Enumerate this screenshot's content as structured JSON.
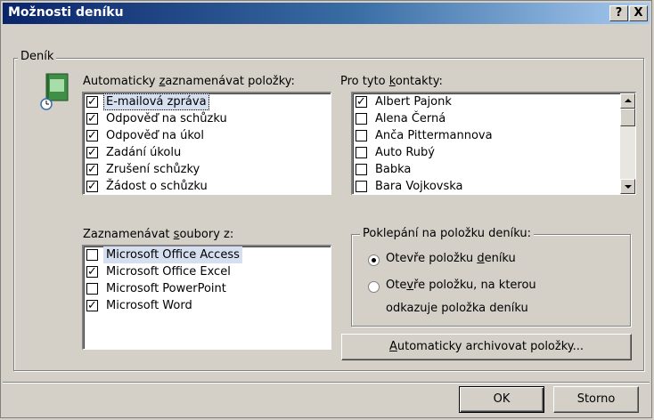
{
  "window": {
    "title": "Možnosti deníku",
    "help_button": "?",
    "close_button": "X"
  },
  "group": {
    "legend": "Deník"
  },
  "auto_record": {
    "label_pre": "Automaticky ",
    "label_u": "z",
    "label_post": "aznamenávat položky:",
    "items": [
      {
        "label": "E-mailová zpráva",
        "checked": true
      },
      {
        "label": "Odpověď na schůzku",
        "checked": true
      },
      {
        "label": "Odpověď na úkol",
        "checked": true
      },
      {
        "label": "Zadání úkolu",
        "checked": true
      },
      {
        "label": "Zrušení schůzky",
        "checked": true
      },
      {
        "label": "Žádost o schůzku",
        "checked": true
      }
    ]
  },
  "contacts": {
    "label_pre": "Pro tyto ",
    "label_u": "k",
    "label_post": "ontakty:",
    "items": [
      {
        "label": "Albert Pajonk",
        "checked": true
      },
      {
        "label": "Alena Černá",
        "checked": false
      },
      {
        "label": "Anča Pittermannova",
        "checked": false
      },
      {
        "label": "Auto Rubý",
        "checked": false
      },
      {
        "label": "Babka",
        "checked": false
      },
      {
        "label": "Bara Vojkovska",
        "checked": false
      }
    ]
  },
  "files": {
    "label_pre": "Zaznamenávat ",
    "label_u": "s",
    "label_post": "oubory z:",
    "items": [
      {
        "label": "Microsoft Office Access",
        "checked": false
      },
      {
        "label": "Microsoft Office Excel",
        "checked": true
      },
      {
        "label": "Microsoft PowerPoint",
        "checked": false
      },
      {
        "label": "Microsoft Word",
        "checked": true
      }
    ]
  },
  "double_click": {
    "legend": "Poklepání na položku deníku:",
    "option1_pre": "Otevře položku ",
    "option1_u": "d",
    "option1_post": "eníku",
    "option2_pre": "Ote",
    "option2_u": "v",
    "option2_post": "ře položku, na kterou",
    "option2_line2": "odkazuje položka deníku",
    "selected": 1
  },
  "archive_button": {
    "pre": "",
    "u": "A",
    "post": "utomaticky archivovat položky..."
  },
  "ok_label": "OK",
  "cancel_label": "Storno",
  "check_glyph": "✓"
}
